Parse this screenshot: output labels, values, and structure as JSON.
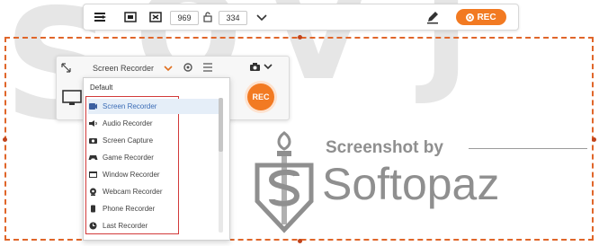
{
  "toolbar": {
    "width_value": "969",
    "height_value": "334",
    "rec_label": "REC",
    "icons": [
      "region-select-icon",
      "fullscreen-icon",
      "window-capture-icon",
      "lock-ratio-icon",
      "chevron-down-icon",
      "pen-icon"
    ]
  },
  "panel": {
    "source_label": "Screen Recorder",
    "rec_label": "REC",
    "icons": [
      "collapse-icon",
      "gear-icon",
      "list-icon",
      "camera-icon",
      "chevron-down-icon",
      "monitor-icon"
    ]
  },
  "dropdown": {
    "default_label": "Default",
    "items": [
      {
        "label": "Screen Recorder",
        "icon": "screen-recorder-icon",
        "selected": true
      },
      {
        "label": "Audio Recorder",
        "icon": "speaker-icon",
        "selected": false
      },
      {
        "label": "Screen Capture",
        "icon": "camera-icon",
        "selected": false
      },
      {
        "label": "Game Recorder",
        "icon": "gamepad-icon",
        "selected": false
      },
      {
        "label": "Window Recorder",
        "icon": "window-icon",
        "selected": false
      },
      {
        "label": "Webcam Recorder",
        "icon": "webcam-icon",
        "selected": false
      },
      {
        "label": "Phone Recorder",
        "icon": "phone-icon",
        "selected": false
      },
      {
        "label": "Last Recorder",
        "icon": "clock-icon",
        "selected": false
      }
    ]
  },
  "watermark": {
    "line1": "Screenshot by",
    "line2": "Softopaz"
  },
  "colors": {
    "accent": "#f27a22",
    "capture_border": "#e0662a",
    "highlight_border": "#d23a3a",
    "selected_bg": "#e5eef8"
  }
}
